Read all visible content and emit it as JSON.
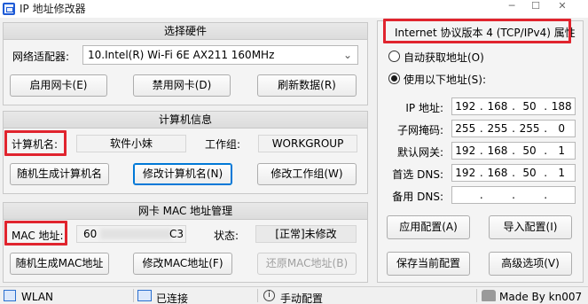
{
  "window": {
    "title": "IP 地址修改器"
  },
  "hardware": {
    "header": "选择硬件",
    "adapter_label": "网络适配器:",
    "adapter_value": "10.Intel(R) Wi-Fi 6E AX211 160MHz",
    "enable_label": "启用网卡(E)",
    "disable_label": "禁用网卡(D)",
    "refresh_label": "刷新数据(R)"
  },
  "computer": {
    "header": "计算机信息",
    "name_label": "计算机名:",
    "name_value": "软件小妹",
    "workgroup_label": "工作组:",
    "workgroup_value": "WORKGROUP",
    "random_name_label": "随机生成计算机名",
    "modify_name_label": "修改计算机名(N)",
    "modify_workgroup_label": "修改工作组(W)"
  },
  "mac": {
    "header": "网卡 MAC 地址管理",
    "mac_label": "MAC 地址:",
    "mac_value_start": "60",
    "mac_value_end": "C3",
    "status_label": "状态:",
    "status_value": "[正常]未修改",
    "random_mac_label": "随机生成MAC地址",
    "modify_mac_label": "修改MAC地址(F)",
    "restore_mac_label": "还原MAC地址(B)"
  },
  "ipv4": {
    "header": "Internet 协议版本 4 (TCP/IPv4) 属性",
    "auto_label": "自动获取地址(O)",
    "manual_label": "使用以下地址(S):",
    "ip_label": "IP 地址:",
    "ip": [
      "192",
      "168",
      "50",
      "188"
    ],
    "mask_label": "子网掩码:",
    "mask": [
      "255",
      "255",
      "255",
      "0"
    ],
    "gateway_label": "默认网关:",
    "gateway": [
      "192",
      "168",
      "50",
      "1"
    ],
    "dns1_label": "首选 DNS:",
    "dns1": [
      "192",
      "168",
      "50",
      "1"
    ],
    "dns2_label": "备用 DNS:",
    "dns2": [
      "",
      "",
      "",
      ""
    ],
    "apply_label": "应用配置(A)",
    "import_label": "导入配置(I)",
    "save_label": "保存当前配置",
    "advanced_label": "高级选项(V)"
  },
  "statusbar": {
    "adapter": "WLAN",
    "connection": "已连接",
    "mode": "手动配置",
    "author": "Made By kn007"
  },
  "colors": {
    "highlight": "#e0242e",
    "accent": "#0078d7"
  }
}
